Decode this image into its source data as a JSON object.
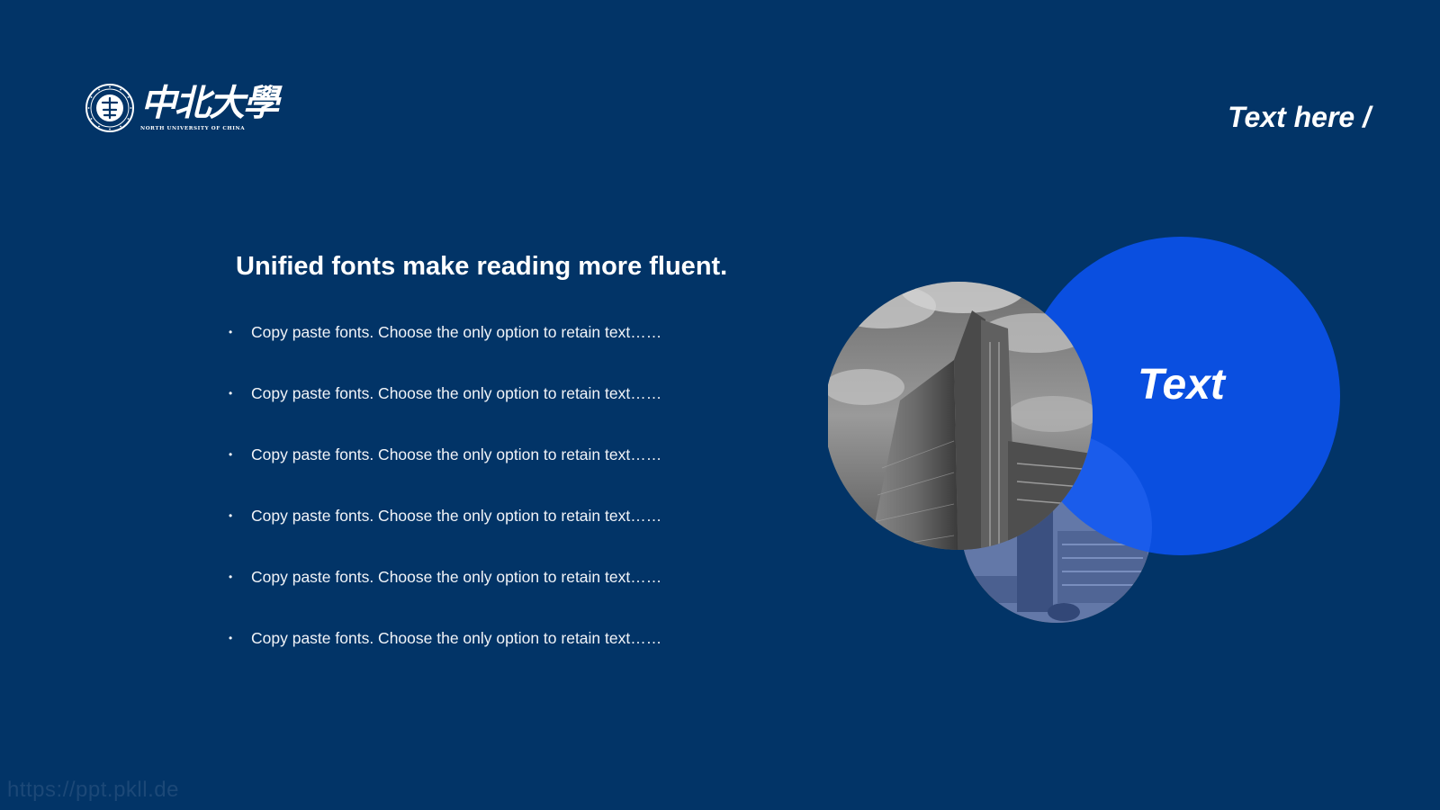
{
  "logo": {
    "chinese_name": "中北大學",
    "english_name": "NORTH UNIVERSITY OF CHINA",
    "seal_icon": "university-seal-icon"
  },
  "header": {
    "label": "Text here /"
  },
  "content": {
    "title": "Unified fonts make reading more fluent.",
    "bullet_glyph": "•",
    "bullets": [
      "Copy paste fonts. Choose the only option to retain text……",
      "Copy paste fonts. Choose the only option to retain text……",
      "Copy paste fonts. Choose the only option to retain text……",
      "Copy paste fonts. Choose the only option to retain text……",
      "Copy paste fonts. Choose the only option to retain text……",
      "Copy paste fonts. Choose the only option to retain text……"
    ]
  },
  "graphic": {
    "circle_label": "Text",
    "accent_color": "#0a4fe0"
  },
  "watermark": {
    "text": "https://ppt.pkll.de"
  },
  "colors": {
    "background": "#023467",
    "text": "#ffffff"
  }
}
